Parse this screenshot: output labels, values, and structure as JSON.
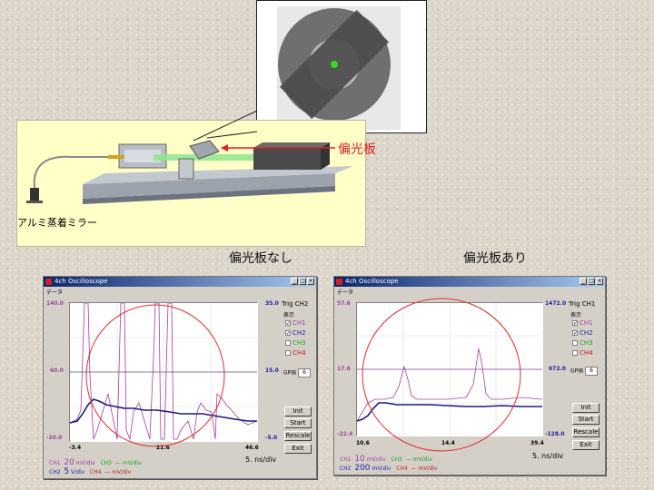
{
  "setup_image": {
    "mirror_label": "アルミ蒸着ミラー",
    "polarizer_label": "偏光板",
    "polarizer_color": "#e02020",
    "panel_color": "#ffffc8"
  },
  "captions": {
    "left": "偏光板なし",
    "right": "偏光板あり"
  },
  "scopes": [
    {
      "id": "left",
      "window_title": "4ch Oscilloscope",
      "menu": "データ",
      "left_axis": {
        "top": "140.0",
        "mid": "60.0",
        "bottom": "-20.0"
      },
      "right_axis": {
        "top": "35.0",
        "mid": "15.0",
        "bottom": "-5.0"
      },
      "x_ticks": [
        "-3.4",
        "21.6",
        "46.6"
      ],
      "trig_label": "Trig",
      "trig_channel": "CH2",
      "display_label": "表示",
      "channels": [
        {
          "label": "CH1",
          "checked": true,
          "color": "#a040a0"
        },
        {
          "label": "CH2",
          "checked": true,
          "color": "#2020a0"
        },
        {
          "label": "CH3",
          "checked": false,
          "color": "#20a020"
        },
        {
          "label": "CH4",
          "checked": false,
          "color": "#c02020"
        }
      ],
      "gpib_label": "GPIB",
      "gpib_value": "6",
      "buttons": {
        "init": "Init",
        "start": "Start",
        "rescale": "Rescale",
        "exit": "Exit"
      },
      "time_div": "5. ns/div",
      "footer": [
        {
          "ch": "CH1",
          "val": "20",
          "unit": "mV/div",
          "ch2": "CH3",
          "val2": "—",
          "unit2": "mV/div"
        },
        {
          "ch": "CH2",
          "val": "5",
          "unit": "V/div",
          "ch2": "CH4",
          "val2": "—",
          "unit2": "mV/div"
        }
      ]
    },
    {
      "id": "right",
      "window_title": "4ch Oscilloscope",
      "menu": "データ",
      "left_axis": {
        "top": "57.6",
        "mid": "17.6",
        "bottom": "-22.4"
      },
      "right_axis": {
        "top": "1472.0",
        "mid": "672.0",
        "bottom": "-128.0"
      },
      "x_ticks": [
        "10.6",
        "14.4",
        "39.4"
      ],
      "trig_label": "Trig",
      "trig_channel": "CH1",
      "display_label": "表示",
      "channels": [
        {
          "label": "CH1",
          "checked": true,
          "color": "#a040a0"
        },
        {
          "label": "CH2",
          "checked": true,
          "color": "#2020a0"
        },
        {
          "label": "CH3",
          "checked": false,
          "color": "#20a020"
        },
        {
          "label": "CH4",
          "checked": false,
          "color": "#c02020"
        }
      ],
      "gpib_label": "GPIB",
      "gpib_value": "6",
      "buttons": {
        "init": "Init",
        "start": "Start",
        "rescale": "Rescale",
        "exit": "Exit"
      },
      "time_div": "5. ns/div",
      "footer": [
        {
          "ch": "CH1",
          "val": "10",
          "unit": "mV/div",
          "ch2": "CH3",
          "val2": "—",
          "unit2": "mV/div"
        },
        {
          "ch": "CH2",
          "val": "200",
          "unit": "mV/div",
          "ch2": "CH4",
          "val2": "—",
          "unit2": "mV/div"
        }
      ]
    }
  ]
}
